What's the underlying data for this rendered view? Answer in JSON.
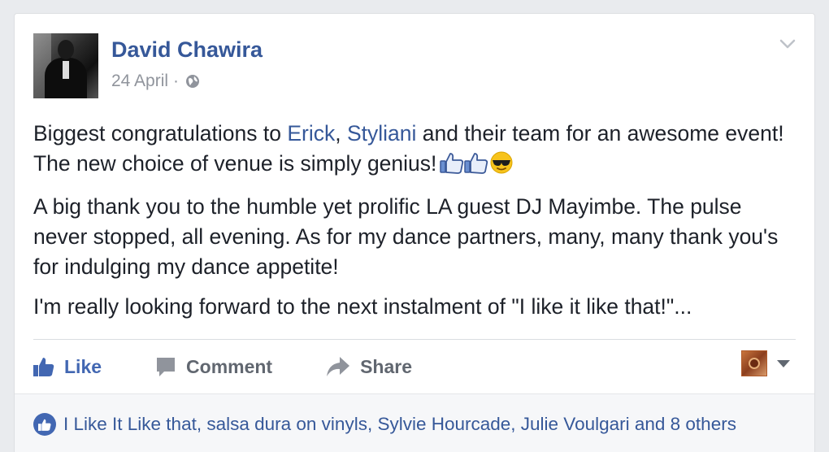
{
  "post": {
    "author": "David Chawira",
    "date": "24 April",
    "separator": "·",
    "privacy_icon": "globe-icon",
    "paragraph1": {
      "prefix": "Biggest congratulations to ",
      "mention1": "Erick",
      "comma": ", ",
      "mention2": "Styliani",
      "suffix": " and their team for an awesome event! The new choice of venue is simply genius!"
    },
    "paragraph2": "A big thank you to the humble yet prolific LA guest DJ Mayimbe. The pulse never stopped, all evening. As for my dance partners, many, many thank you's for indulging my dance appetite!",
    "paragraph3": "I'm really looking forward to the next instalment of \"I like it like that!\"..."
  },
  "actions": {
    "like_label": "Like",
    "comment_label": "Comment",
    "share_label": "Share"
  },
  "likes": {
    "text": "I Like It Like that, salsa dura on vinyls, Sylvie Hourcade, Julie Voulgari and 8 others"
  },
  "colors": {
    "link": "#365899",
    "like_blue": "#4267b2",
    "muted": "#90949c",
    "background": "#e9ebee"
  }
}
